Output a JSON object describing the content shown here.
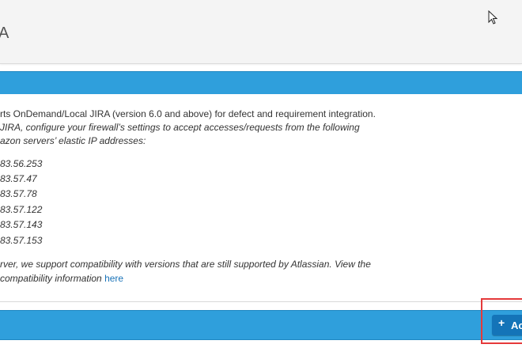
{
  "header": {
    "title": "A"
  },
  "intro": {
    "line1": "rts OnDemand/Local JIRA (version 6.0 and above) for defect and requirement integration.",
    "line2": "JIRA, configure your firewall’s settings to accept accesses/requests from the following",
    "line3": "azon servers’ elastic IP addresses:"
  },
  "ips": [
    "83.56.253",
    "83.57.47",
    "83.57.78",
    "83.57.122",
    "83.57.143",
    "83.57.153"
  ],
  "compat": {
    "line1": "rver, we support compatibility with versions that are still supported by Atlassian. View the",
    "line2": "compatibility information ",
    "link": "here"
  },
  "action": {
    "plus": "+",
    "label": "Ac"
  },
  "colors": {
    "bar": "#2f9fdc",
    "button": "#1474b8",
    "highlight": "#e5393a",
    "link": "#1a73b8"
  },
  "icons": {
    "cursor": "mouse-pointer-icon"
  }
}
